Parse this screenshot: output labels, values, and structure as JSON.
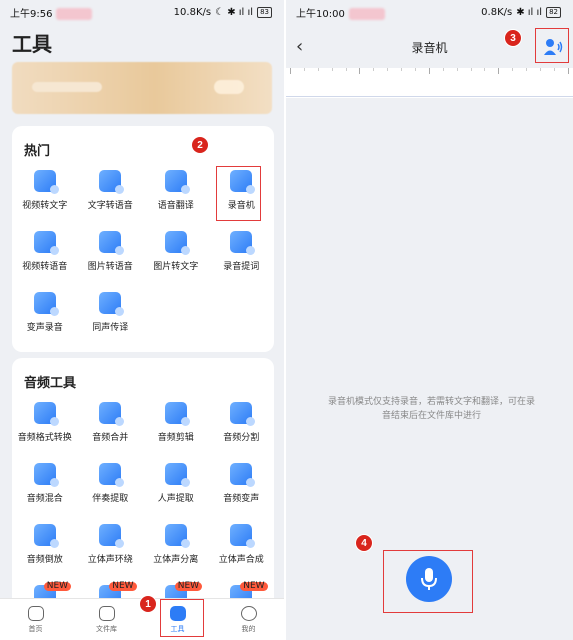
{
  "left": {
    "status": {
      "time": "上午9:56",
      "speed": "10.8K/s",
      "battery": "83"
    },
    "title": "工具",
    "hot": {
      "heading": "热门",
      "items": [
        "视频转文字",
        "文字转语音",
        "语音翻译",
        "录音机",
        "视频转语音",
        "图片转语音",
        "图片转文字",
        "录音提词",
        "变声录音",
        "同声传译"
      ]
    },
    "audio": {
      "heading": "音频工具",
      "items": [
        "音频格式转换",
        "音频合并",
        "音频剪辑",
        "音频分割",
        "音频混合",
        "伴奏提取",
        "人声提取",
        "音频变声",
        "音频倒放",
        "立体声环绕",
        "立体声分离",
        "立体声合成"
      ],
      "new_label": "NEW"
    },
    "nav": [
      "首页",
      "文件库",
      "工具",
      "我的"
    ]
  },
  "right": {
    "status": {
      "time": "上午10:00",
      "speed": "0.8K/s",
      "battery": "82"
    },
    "title": "录音机",
    "back": "‹",
    "hint": "录音机模式仅支持录音，若需转文字和翻译，可在录音结束后在文件库中进行"
  },
  "badges": [
    "1",
    "2",
    "3",
    "4"
  ],
  "colors": {
    "accent": "#2d7cf6",
    "highlight": "#e23b3b",
    "badge": "#d9251d"
  }
}
